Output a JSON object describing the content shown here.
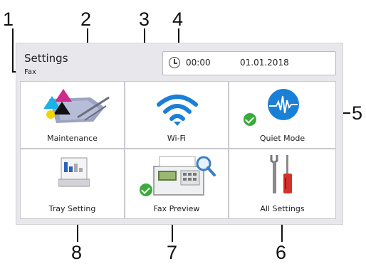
{
  "callouts": [
    "1",
    "2",
    "3",
    "4",
    "5",
    "6",
    "7",
    "8"
  ],
  "header": {
    "title": "Settings",
    "subtitle": "Fax"
  },
  "clock": {
    "time": "00:00",
    "date": "01.01.2018"
  },
  "tiles": [
    {
      "label": "Maintenance",
      "icon": "ink-cartridge-icon"
    },
    {
      "label": "Wi-Fi",
      "icon": "wifi-icon"
    },
    {
      "label": "Quiet Mode",
      "icon": "quiet-mode-icon",
      "status": "on"
    },
    {
      "label": "Tray Setting",
      "icon": "tray-icon"
    },
    {
      "label": "Fax Preview",
      "icon": "fax-preview-icon",
      "status": "on"
    },
    {
      "label": "All Settings",
      "icon": "tools-icon"
    }
  ],
  "colors": {
    "accent_blue": "#1a7fd6",
    "check_green": "#3cab3c",
    "tool_red": "#d6302b"
  }
}
